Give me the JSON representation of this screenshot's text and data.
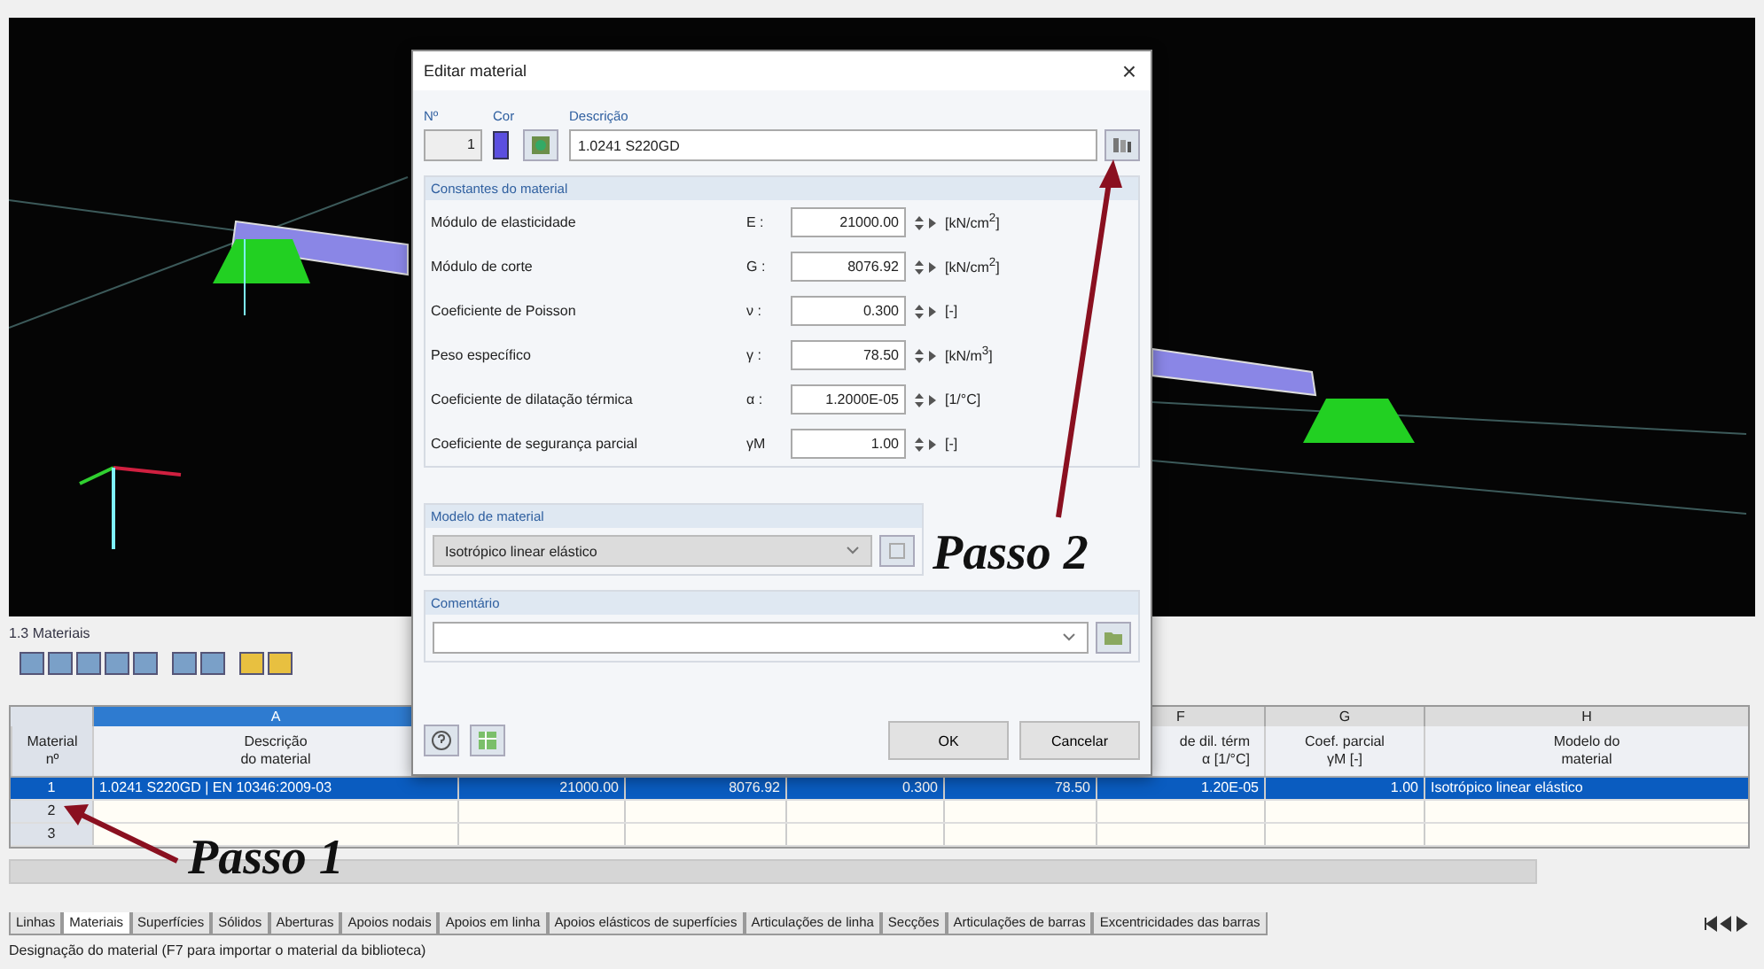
{
  "panel": {
    "title": "1.3 Materiais"
  },
  "table": {
    "row_header": [
      "Material",
      "nº"
    ],
    "columns": [
      {
        "letter": "A",
        "title": [
          "Descrição",
          "do material"
        ]
      },
      {},
      {},
      {},
      {},
      {
        "letter": "F",
        "title": [
          "de dil. térm",
          "α [1/°C]"
        ]
      },
      {
        "letter": "G",
        "title": [
          "Coef. parcial",
          "γM [-]"
        ]
      },
      {
        "letter": "H",
        "title": [
          "Modelo do",
          "material"
        ]
      }
    ],
    "rows": [
      {
        "number": "1",
        "selected": true,
        "cells": [
          "1.0241 S220GD | EN 10346:2009-03",
          "21000.00",
          "8076.92",
          "0.300",
          "78.50",
          "1.20E-05",
          "1.00",
          "Isotrópico linear elástico"
        ]
      },
      {
        "number": "2",
        "selected": false,
        "cells": []
      },
      {
        "number": "3",
        "selected": false,
        "cells": []
      }
    ]
  },
  "sheet_tabs": [
    {
      "label": "Linhas",
      "selected": false
    },
    {
      "label": "Materiais",
      "selected": true
    },
    {
      "label": "Superfícies",
      "selected": false
    },
    {
      "label": "Sólidos",
      "selected": false
    },
    {
      "label": "Aberturas",
      "selected": false
    },
    {
      "label": "Apoios nodais",
      "selected": false
    },
    {
      "label": "Apoios em linha",
      "selected": false
    },
    {
      "label": "Apoios elásticos de superfícies",
      "selected": false
    },
    {
      "label": "Articulações de linha",
      "selected": false
    },
    {
      "label": "Secções",
      "selected": false
    },
    {
      "label": "Articulações de barras",
      "selected": false
    },
    {
      "label": "Excentricidades das barras",
      "selected": false
    }
  ],
  "status_bar": "Designação do material (F7 para importar o material da biblioteca)",
  "dialog": {
    "title": "Editar material",
    "close": "×",
    "number_label": "Nº",
    "number": "1",
    "color_label": "Cor",
    "color": "#5b4fe0",
    "description_label": "Descrição",
    "description": "1.0241 S220GD",
    "constants_title": "Constantes do material",
    "constants": [
      {
        "label": "Módulo de elasticidade",
        "symbol": "E :",
        "value": "21000.00",
        "unit": "[kN/cm$^{2}$]"
      },
      {
        "label": "Módulo de corte",
        "symbol": "G :",
        "value": "8076.92",
        "unit": "[kN/cm$^{2}$]"
      },
      {
        "label": "Coeficiente de Poisson",
        "symbol": "ν :",
        "value": "0.300",
        "unit": "[-]"
      },
      {
        "label": "Peso específico",
        "symbol": "γ :",
        "value": "78.50",
        "unit": "[kN/m$^{3}$]"
      },
      {
        "label": "Coeficiente de dilatação térmica",
        "symbol": "α :",
        "value": "1.2000E-05",
        "unit": "[1/°C]"
      },
      {
        "label": "Coeficiente de segurança parcial",
        "symbol": "γM",
        "value": "1.00",
        "unit": "[-]"
      }
    ],
    "model_title": "Modelo de material",
    "model": "Isotrópico linear elástico",
    "comment_title": "Comentário",
    "ok": "OK",
    "cancel": "Cancelar"
  },
  "annotations": [
    {
      "kind": "step2",
      "text": "Passo 2"
    },
    {
      "kind": "step1",
      "text": "Passo 1"
    }
  ]
}
